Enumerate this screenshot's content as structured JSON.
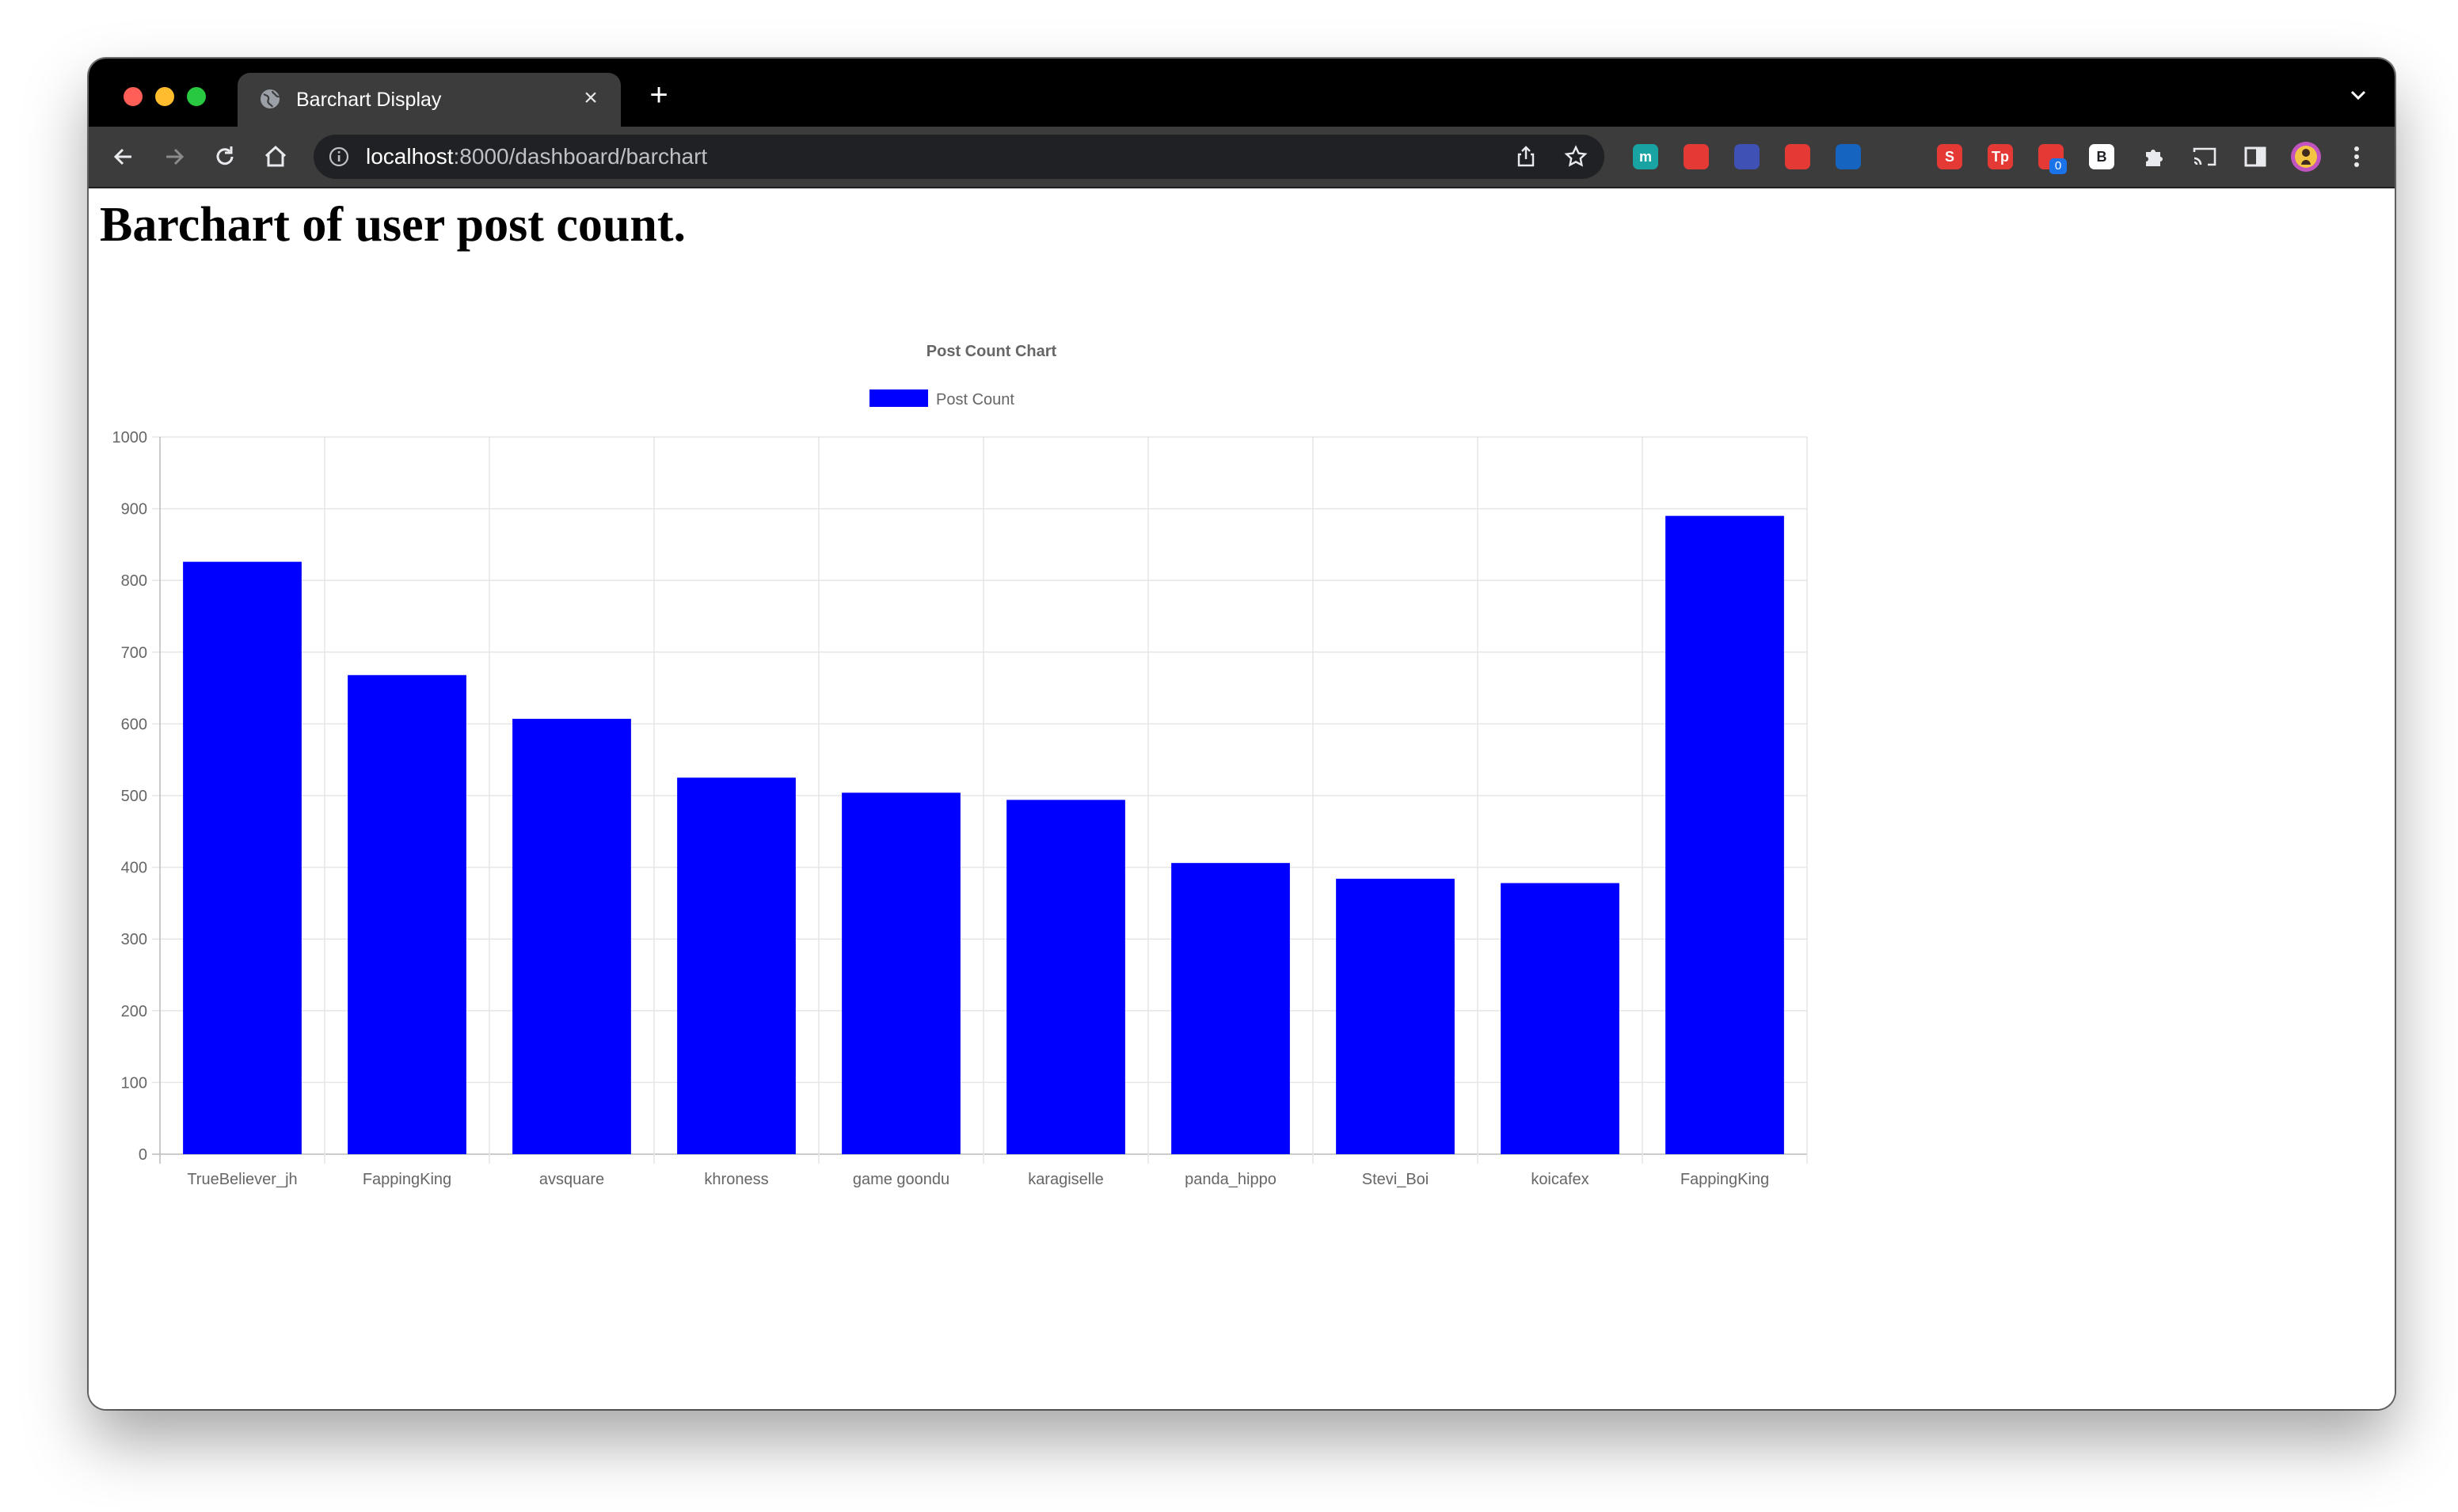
{
  "browser": {
    "tab_title": "Barchart Display",
    "tab_close": "×",
    "new_tab": "+",
    "url_host": "localhost",
    "url_path": ":8000/dashboard/barchart",
    "extensions": [
      {
        "name": "m",
        "color": "#1aa3a3"
      },
      {
        "name": "",
        "color": "#e53935"
      },
      {
        "name": "",
        "color": "#3f51b5"
      },
      {
        "name": "",
        "color": "#e53935"
      },
      {
        "name": "",
        "color": "#1565c0"
      },
      {
        "name": "",
        "color": "#202124"
      },
      {
        "name": "S",
        "color": "#e53935"
      },
      {
        "name": "Tp",
        "color": "#e53935"
      },
      {
        "name": "",
        "color": "#e53935"
      },
      {
        "name": "B",
        "color": "#ffffff"
      }
    ],
    "badge": "0"
  },
  "page": {
    "heading": "Barchart of user post count."
  },
  "chart_data": {
    "type": "bar",
    "title": "Post Count Chart",
    "legend": "top",
    "categories": [
      "TrueBeliever_jh",
      "FappingKing",
      "avsquare",
      "khroness",
      "game goondu",
      "karagiselle",
      "panda_hippo",
      "Stevi_Boi",
      "koicafex",
      "FappingKing"
    ],
    "series": [
      {
        "name": "Post Count",
        "values": [
          826,
          668,
          607,
          525,
          504,
          494,
          406,
          384,
          378,
          890
        ],
        "color": "#0000ff"
      }
    ],
    "ylim": [
      0,
      1000
    ],
    "yticks": [
      0,
      100,
      200,
      300,
      400,
      500,
      600,
      700,
      800,
      900,
      1000
    ],
    "grid": true
  }
}
